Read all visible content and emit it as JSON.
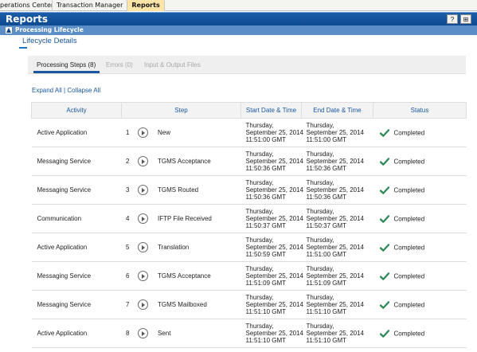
{
  "top_tabs": [
    {
      "label": "perations Center",
      "active": false
    },
    {
      "label": "Transaction Manager",
      "active": false
    },
    {
      "label": "Reports",
      "active": true
    }
  ],
  "title": "Reports",
  "title_icons": [
    "help-icon",
    "grid-icon"
  ],
  "title_icon_glyphs": [
    "?",
    "⊞"
  ],
  "section": {
    "toggle": "▲",
    "label": "Processing Lifecycle"
  },
  "breadcrumb": "Lifecycle Details",
  "subtabs": [
    {
      "label": "Processing Steps (8)",
      "active": true
    },
    {
      "label": "Errors (0)",
      "active": false
    },
    {
      "label": "Input & Output Files",
      "active": false
    }
  ],
  "expand_all": "Expand All",
  "separator": "|",
  "collapse_all": "Collapse All",
  "columns": {
    "activity": "Activity",
    "step": "Step",
    "start": "Start Date & Time",
    "end": "End Date & Time",
    "status": "Status"
  },
  "rows": [
    {
      "activity": "Active Application",
      "num": "1",
      "step": "New",
      "start": [
        "Thursday,",
        "September 25, 2014",
        "11:51:00 GMT"
      ],
      "end": [
        "Thursday,",
        "September 25, 2014",
        "11:51:00 GMT"
      ],
      "status": "Completed"
    },
    {
      "activity": "Messaging Service",
      "num": "2",
      "step": "TGMS Acceptance",
      "start": [
        "Thursday,",
        "September 25, 2014",
        "11:50:36 GMT"
      ],
      "end": [
        "Thursday,",
        "September 25, 2014",
        "11:50:36 GMT"
      ],
      "status": "Completed"
    },
    {
      "activity": "Messaging Service",
      "num": "3",
      "step": "TGMS Routed",
      "start": [
        "Thursday,",
        "September 25, 2014",
        "11:50:36 GMT"
      ],
      "end": [
        "Thursday,",
        "September 25, 2014",
        "11:50:36 GMT"
      ],
      "status": "Completed"
    },
    {
      "activity": "Communication",
      "num": "4",
      "step": "IFTP File Received",
      "start": [
        "Thursday,",
        "September 25, 2014",
        "11:50:37 GMT"
      ],
      "end": [
        "Thursday,",
        "September 25, 2014",
        "11:50:37 GMT"
      ],
      "status": "Completed"
    },
    {
      "activity": "Active Application",
      "num": "5",
      "step": "Translation",
      "start": [
        "Thursday,",
        "September 25, 2014",
        "11:50:59 GMT"
      ],
      "end": [
        "Thursday,",
        "September 25, 2014",
        "11:51:00 GMT"
      ],
      "status": "Completed"
    },
    {
      "activity": "Messaging Service",
      "num": "6",
      "step": "TGMS Acceptance",
      "start": [
        "Thursday,",
        "September 25, 2014",
        "11:51:09 GMT"
      ],
      "end": [
        "Thursday,",
        "September 25, 2014",
        "11:51:09 GMT"
      ],
      "status": "Completed"
    },
    {
      "activity": "Messaging Service",
      "num": "7",
      "step": "TGMS Mailboxed",
      "start": [
        "Thursday,",
        "September 25, 2014",
        "11:51:10 GMT"
      ],
      "end": [
        "Thursday,",
        "September 25, 2014",
        "11:51:10 GMT"
      ],
      "status": "Completed"
    },
    {
      "activity": "Active Application",
      "num": "8",
      "step": "Sent",
      "start": [
        "Thursday,",
        "September 25, 2014",
        "11:51:10 GMT"
      ],
      "end": [
        "Thursday,",
        "September 25, 2014",
        "11:51:10 GMT"
      ],
      "status": "Completed"
    }
  ],
  "colors": {
    "title_bar": "#0e4b91",
    "section_bar": "#5b8ec6",
    "link": "#1a58a0",
    "check": "#2e8b57",
    "active_tab": "#ffe4a8"
  }
}
